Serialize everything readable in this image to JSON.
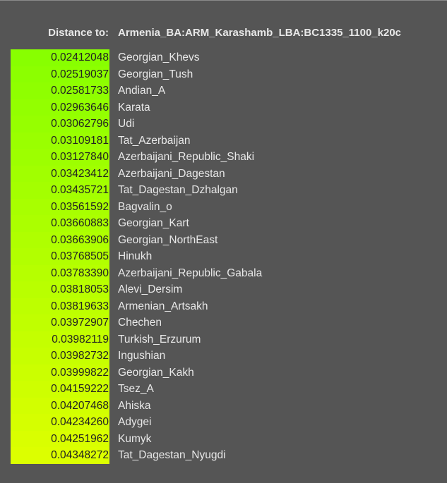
{
  "header": {
    "label": "Distance to:",
    "target": "Armenia_BA:ARM_Karashamb_LBA:BC1335_1100_k20c"
  },
  "colors": {
    "background": "#555555",
    "text": "#e8e8e8",
    "nearest": "#88ff00",
    "farthest": "#dcff00"
  },
  "results": [
    {
      "distance": "0.02412048",
      "population": "Georgian_Khevs"
    },
    {
      "distance": "0.02519037",
      "population": "Georgian_Tush"
    },
    {
      "distance": "0.02581733",
      "population": "Andian_A"
    },
    {
      "distance": "0.02963646",
      "population": "Karata"
    },
    {
      "distance": "0.03062796",
      "population": "Udi"
    },
    {
      "distance": "0.03109181",
      "population": "Tat_Azerbaijan"
    },
    {
      "distance": "0.03127840",
      "population": "Azerbaijani_Republic_Shaki"
    },
    {
      "distance": "0.03423412",
      "population": "Azerbaijani_Dagestan"
    },
    {
      "distance": "0.03435721",
      "population": "Tat_Dagestan_Dzhalgan"
    },
    {
      "distance": "0.03561592",
      "population": "Bagvalin_o"
    },
    {
      "distance": "0.03660883",
      "population": "Georgian_Kart"
    },
    {
      "distance": "0.03663906",
      "population": "Georgian_NorthEast"
    },
    {
      "distance": "0.03768505",
      "population": "Hinukh"
    },
    {
      "distance": "0.03783390",
      "population": "Azerbaijani_Republic_Gabala"
    },
    {
      "distance": "0.03818053",
      "population": "Alevi_Dersim"
    },
    {
      "distance": "0.03819633",
      "population": "Armenian_Artsakh"
    },
    {
      "distance": "0.03972907",
      "population": "Chechen"
    },
    {
      "distance": "0.03982119",
      "population": "Turkish_Erzurum"
    },
    {
      "distance": "0.03982732",
      "population": "Ingushian"
    },
    {
      "distance": "0.03999822",
      "population": "Georgian_Kakh"
    },
    {
      "distance": "0.04159222",
      "population": "Tsez_A"
    },
    {
      "distance": "0.04207468",
      "population": "Ahiska"
    },
    {
      "distance": "0.04234260",
      "population": "Adygei"
    },
    {
      "distance": "0.04251962",
      "population": "Kumyk"
    },
    {
      "distance": "0.04348272",
      "population": "Tat_Dagestan_Nyugdi"
    }
  ]
}
